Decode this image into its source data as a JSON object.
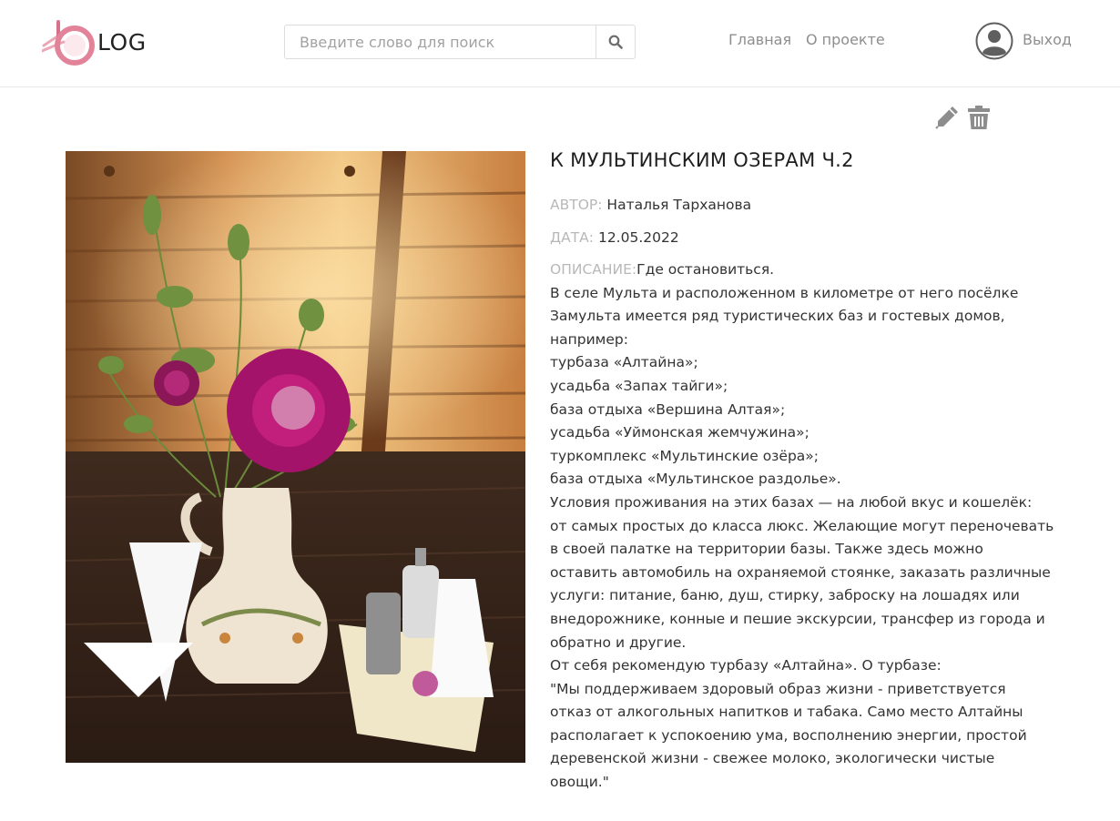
{
  "header": {
    "logo_text": "LOG",
    "search_placeholder": "Введите слово для поиск",
    "search_value": "",
    "nav": {
      "home": "Главная",
      "about": "О проекте"
    },
    "logout": "Выход"
  },
  "icons": {
    "search": "search-icon",
    "user": "user-icon",
    "edit": "pencil-icon",
    "delete": "trash-icon"
  },
  "colors": {
    "logo_pink": "#e2839a",
    "muted": "#8e8e8e",
    "label": "#b8b8b8"
  },
  "post": {
    "title": "К МУЛЬТИНСКИМ ОЗЕРАМ Ч.2",
    "author_label": "АВТОР:",
    "author": "Наталья Тарханова",
    "date_label": "ДАТА:",
    "date": "12.05.2022",
    "description_label": "ОПИСАНИЕ:",
    "description_first": "Где остановиться.",
    "description_lines": [
      "В селе Мульта и расположенном в километре от него посёлке",
      "Замульта имеется ряд туристических баз и гостевых домов,",
      "например:",
      "турбаза «Алтайна»;",
      "усадьба «Запах тайги»;",
      "база отдыха «Вершина Алтая»;",
      "усадьба «Уймонская жемчужина»;",
      "туркомплекс «Мультинские озёра»;",
      "база отдыха «Мультинское раздолье».",
      "Условия проживания на этих базах — на любой вкус и кошелёк:",
      "от самых простых до класса люкс. Желающие могут переночевать",
      "в своей палатке на территории базы. Также здесь можно",
      "оставить автомобиль на охраняемой стоянке, заказать различные",
      "услуги: питание, баню, душ, стирку, заброску на лошадях или",
      "внедорожнике, конные и пешие экскурсии, трансфер из города и",
      "обратно и другие.",
      "От себя рекомендую турбазу «Алтайна». О турбазе:",
      "\"Мы поддерживаем здоровый образ жизни - приветствуется",
      "отказ от алкогольных напитков и табака. Само место Алтайны",
      "располагает к успокоению ума, восполнению энергии, простой",
      "деревенской жизни - свежее молоко, экологически чистые",
      "овощи.\""
    ]
  }
}
